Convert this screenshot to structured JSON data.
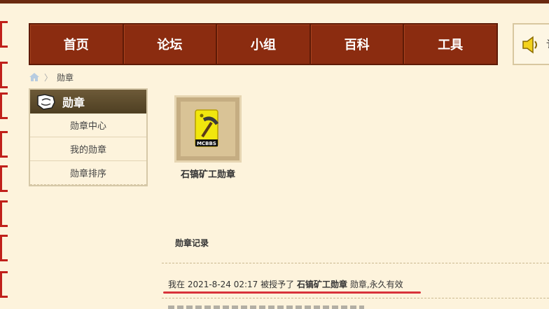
{
  "nav": {
    "items": [
      "首页",
      "论坛",
      "小组",
      "百科",
      "工具"
    ]
  },
  "speaker": {
    "icon": "speaker-icon",
    "text": "讠"
  },
  "breadcrumb": {
    "home_icon": "home-icon",
    "sep": "〉",
    "current": "勋章"
  },
  "sidebar": {
    "title": "勋章",
    "title_icon": "medal-icon",
    "items": [
      {
        "label": "勋章中心"
      },
      {
        "label": "我的勋章"
      },
      {
        "label": "勋章排序"
      }
    ]
  },
  "badge": {
    "name": "石镐矿工勋章",
    "icon": "stone-pickaxe-badge-icon",
    "badge_text": "MCBBS"
  },
  "records": {
    "title": "勋章记录",
    "entry": {
      "prefix": "我在 2021-8-24 02:17 被授予了",
      "badge": "石镐矿工勋章",
      "suffix": "勋章,永久有效"
    }
  },
  "colors": {
    "nav_bg": "#8b2c10",
    "page_bg": "#fdf3dc",
    "highlight": "#d8323a"
  }
}
